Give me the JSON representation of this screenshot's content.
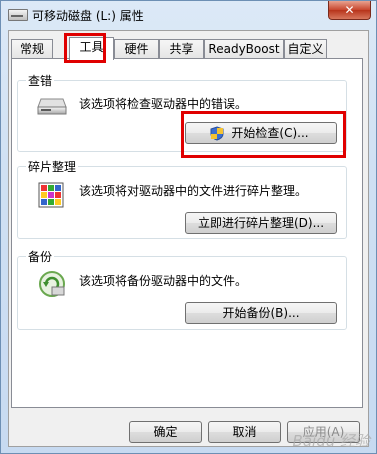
{
  "window": {
    "title": "可移动磁盘 (L:) 属性",
    "close_glyph": "✕"
  },
  "tabs": [
    {
      "label": "常规",
      "active": false
    },
    {
      "label": "工具",
      "active": true
    },
    {
      "label": "硬件",
      "active": false
    },
    {
      "label": "共享",
      "active": false
    },
    {
      "label": "ReadyBoost",
      "active": false
    },
    {
      "label": "自定义",
      "active": false
    }
  ],
  "sections": {
    "error_check": {
      "title": "查错",
      "description": "该选项将检查驱动器中的错误。",
      "button": "开始检查(C)...",
      "icon": "drive-icon"
    },
    "defrag": {
      "title": "碎片整理",
      "description": "该选项将对驱动器中的文件进行碎片整理。",
      "button": "立即进行碎片整理(D)...",
      "icon": "defrag-icon"
    },
    "backup": {
      "title": "备份",
      "description": "该选项将备份驱动器中的文件。",
      "button": "开始备份(B)...",
      "icon": "backup-icon"
    }
  },
  "footer": {
    "ok": "确定",
    "cancel": "取消",
    "apply": "应用(A)"
  },
  "watermark": "Baidu 经验",
  "colors": {
    "highlight": "#e00000",
    "title_bg": "#cfe0f3"
  }
}
